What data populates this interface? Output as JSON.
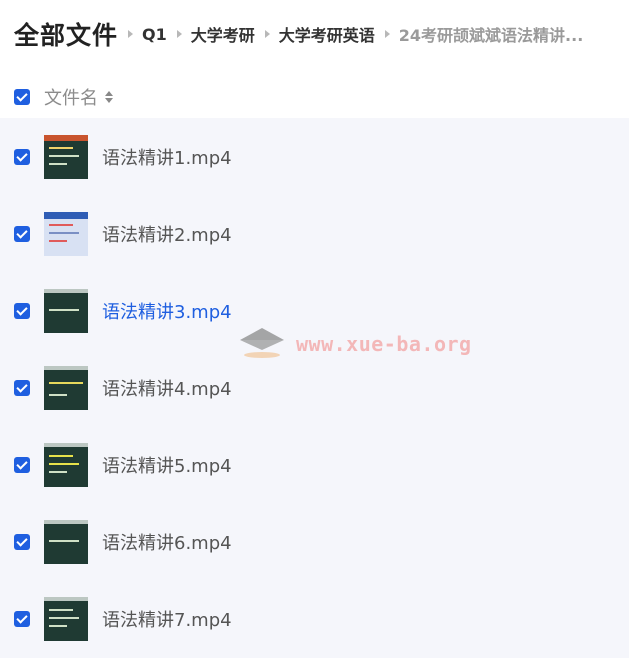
{
  "breadcrumb": {
    "root": "全部文件",
    "items": [
      "Q1",
      "大学考研",
      "大学考研英语",
      "24考研颉斌斌语法精讲..."
    ]
  },
  "list_header": {
    "column_label": "文件名",
    "select_all_checked": true
  },
  "files": [
    {
      "name": "语法精讲1.mp4",
      "checked": true
    },
    {
      "name": "语法精讲2.mp4",
      "checked": true
    },
    {
      "name": "语法精讲3.mp4",
      "checked": true,
      "hovered": true
    },
    {
      "name": "语法精讲4.mp4",
      "checked": true
    },
    {
      "name": "语法精讲5.mp4",
      "checked": true
    },
    {
      "name": "语法精讲6.mp4",
      "checked": true
    },
    {
      "name": "语法精讲7.mp4",
      "checked": true
    }
  ],
  "watermark": {
    "text": "www.xue-ba.org"
  },
  "colors": {
    "accent": "#1f5fe0",
    "list_bg": "#f5f6fb",
    "watermark": "#f3a8a8"
  }
}
